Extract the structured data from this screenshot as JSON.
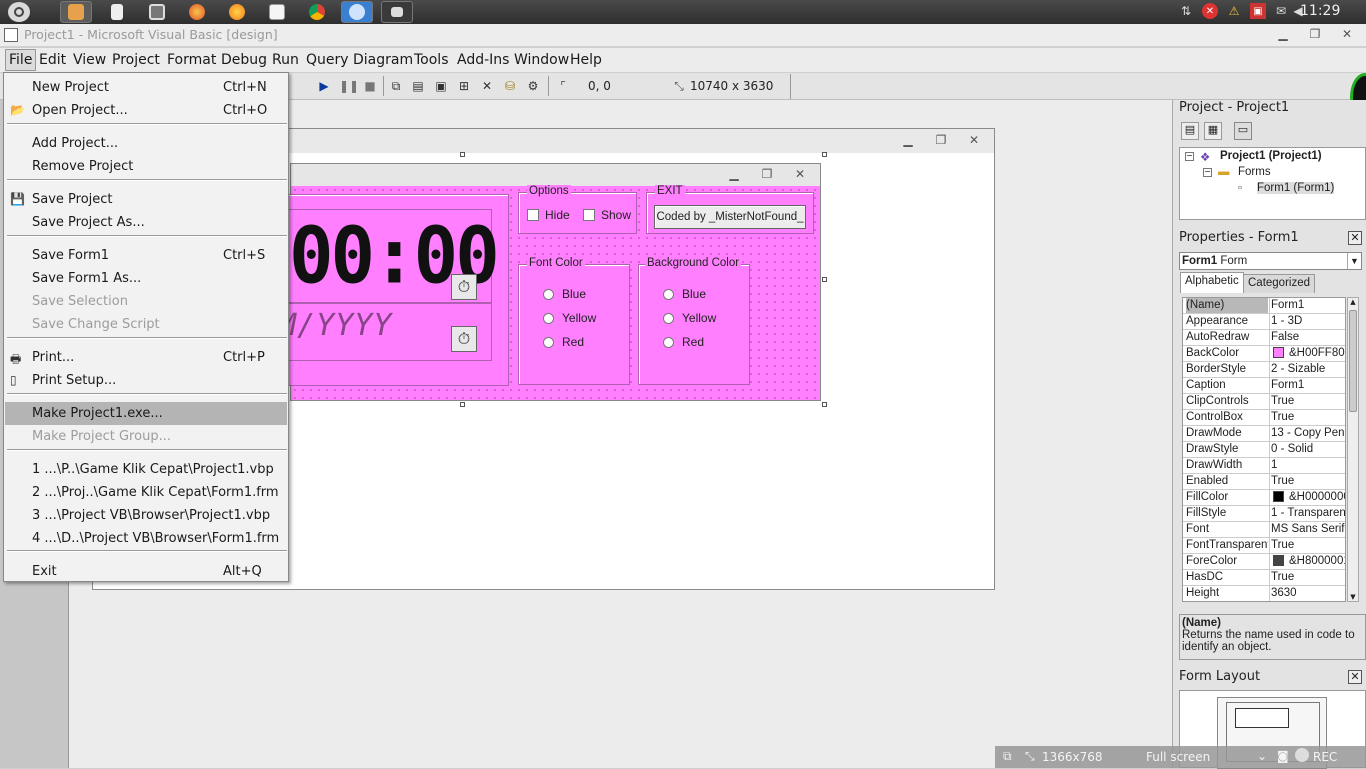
{
  "panel": {
    "clock": "11:29",
    "task_icons": [
      "dash-icon",
      "files-icon",
      "document-icon",
      "image-viewer-icon",
      "firefox-icon",
      "vlc-icon",
      "calculator-icon",
      "chrome-icon",
      "messenger-icon",
      "vb-app-icon"
    ]
  },
  "window": {
    "title": "Project1 - Microsoft Visual Basic [design]"
  },
  "menubar": {
    "items": [
      "File",
      "Edit",
      "View",
      "Project",
      "Format",
      "Debug",
      "Run",
      "Query",
      "Diagram",
      "Tools",
      "Add-Ins",
      "Window",
      "Help"
    ]
  },
  "toolbar": {
    "position": "0, 0",
    "size": "10740 x 3630"
  },
  "file_menu": {
    "items": [
      {
        "label": "New Project",
        "shortcut": "Ctrl+N",
        "state": "normal"
      },
      {
        "label": "Open Project...",
        "shortcut": "Ctrl+O",
        "state": "normal"
      },
      {
        "label": "Add Project...",
        "shortcut": "",
        "state": "normal"
      },
      {
        "label": "Remove Project",
        "shortcut": "",
        "state": "normal"
      },
      {
        "label": "Save Project",
        "shortcut": "",
        "state": "normal"
      },
      {
        "label": "Save Project As...",
        "shortcut": "",
        "state": "normal"
      },
      {
        "label": "Save Form1",
        "shortcut": "Ctrl+S",
        "state": "normal"
      },
      {
        "label": "Save Form1 As...",
        "shortcut": "",
        "state": "normal"
      },
      {
        "label": "Save Selection",
        "shortcut": "",
        "state": "disabled"
      },
      {
        "label": "Save Change Script",
        "shortcut": "",
        "state": "disabled"
      },
      {
        "label": "Print...",
        "shortcut": "Ctrl+P",
        "state": "normal"
      },
      {
        "label": "Print Setup...",
        "shortcut": "",
        "state": "normal"
      },
      {
        "label": "Make Project1.exe...",
        "shortcut": "",
        "state": "highlighted"
      },
      {
        "label": "Make Project Group...",
        "shortcut": "",
        "state": "disabled"
      },
      {
        "label": "1 ...\\P..\\Game Klik Cepat\\Project1.vbp",
        "shortcut": "",
        "state": "normal"
      },
      {
        "label": "2 ...\\Proj..\\Game Klik Cepat\\Form1.frm",
        "shortcut": "",
        "state": "normal"
      },
      {
        "label": "3 ...\\Project VB\\Browser\\Project1.vbp",
        "shortcut": "",
        "state": "normal"
      },
      {
        "label": "4 ...\\D..\\Project VB\\Browser\\Form1.frm",
        "shortcut": "",
        "state": "normal"
      },
      {
        "label": "Exit",
        "shortcut": "Alt+Q",
        "state": "normal"
      }
    ]
  },
  "form": {
    "time_display": "00:00",
    "date_display": "MM/YYYY",
    "options_caption": "Options",
    "hide_label": "Hide",
    "show_label": "Show",
    "exit_caption": "EXIT",
    "exit_button": "Coded by _MisterNotFound_",
    "font_color_caption": "Font Color",
    "bg_color_caption": "Background Color",
    "color_options": [
      "Blue",
      "Yellow",
      "Red"
    ],
    "back_color": "#ff7fff"
  },
  "project_panel": {
    "title": "Project - Project1",
    "root": "Project1 (Project1)",
    "folder": "Forms",
    "form": "Form1 (Form1)"
  },
  "properties_panel": {
    "title": "Properties - Form1",
    "object_name": "Form1",
    "object_type": "Form",
    "tab_alphabetic": "Alphabetic",
    "tab_categorized": "Categorized",
    "rows": [
      {
        "name": "(Name)",
        "value": "Form1"
      },
      {
        "name": "Appearance",
        "value": "1 - 3D"
      },
      {
        "name": "AutoRedraw",
        "value": "False"
      },
      {
        "name": "BackColor",
        "value": "&H00FF80FF&",
        "swatch": "#ff80ff"
      },
      {
        "name": "BorderStyle",
        "value": "2 - Sizable"
      },
      {
        "name": "Caption",
        "value": "Form1"
      },
      {
        "name": "ClipControls",
        "value": "True"
      },
      {
        "name": "ControlBox",
        "value": "True"
      },
      {
        "name": "DrawMode",
        "value": "13 - Copy Pen"
      },
      {
        "name": "DrawStyle",
        "value": "0 - Solid"
      },
      {
        "name": "DrawWidth",
        "value": "1"
      },
      {
        "name": "Enabled",
        "value": "True"
      },
      {
        "name": "FillColor",
        "value": "&H00000000&",
        "swatch": "#000000"
      },
      {
        "name": "FillStyle",
        "value": "1 - Transparent"
      },
      {
        "name": "Font",
        "value": "MS Sans Serif"
      },
      {
        "name": "FontTransparent",
        "value": "True"
      },
      {
        "name": "ForeColor",
        "value": "&H80000012&",
        "swatch": "#444444"
      },
      {
        "name": "HasDC",
        "value": "True"
      },
      {
        "name": "Height",
        "value": "3630"
      }
    ],
    "desc_title": "(Name)",
    "desc_text": "Returns the name used in code to identify an object."
  },
  "form_layout": {
    "title": "Form Layout"
  },
  "statusbar": {
    "resolution": "1366x768",
    "mode": "Full screen",
    "rec": "REC"
  }
}
